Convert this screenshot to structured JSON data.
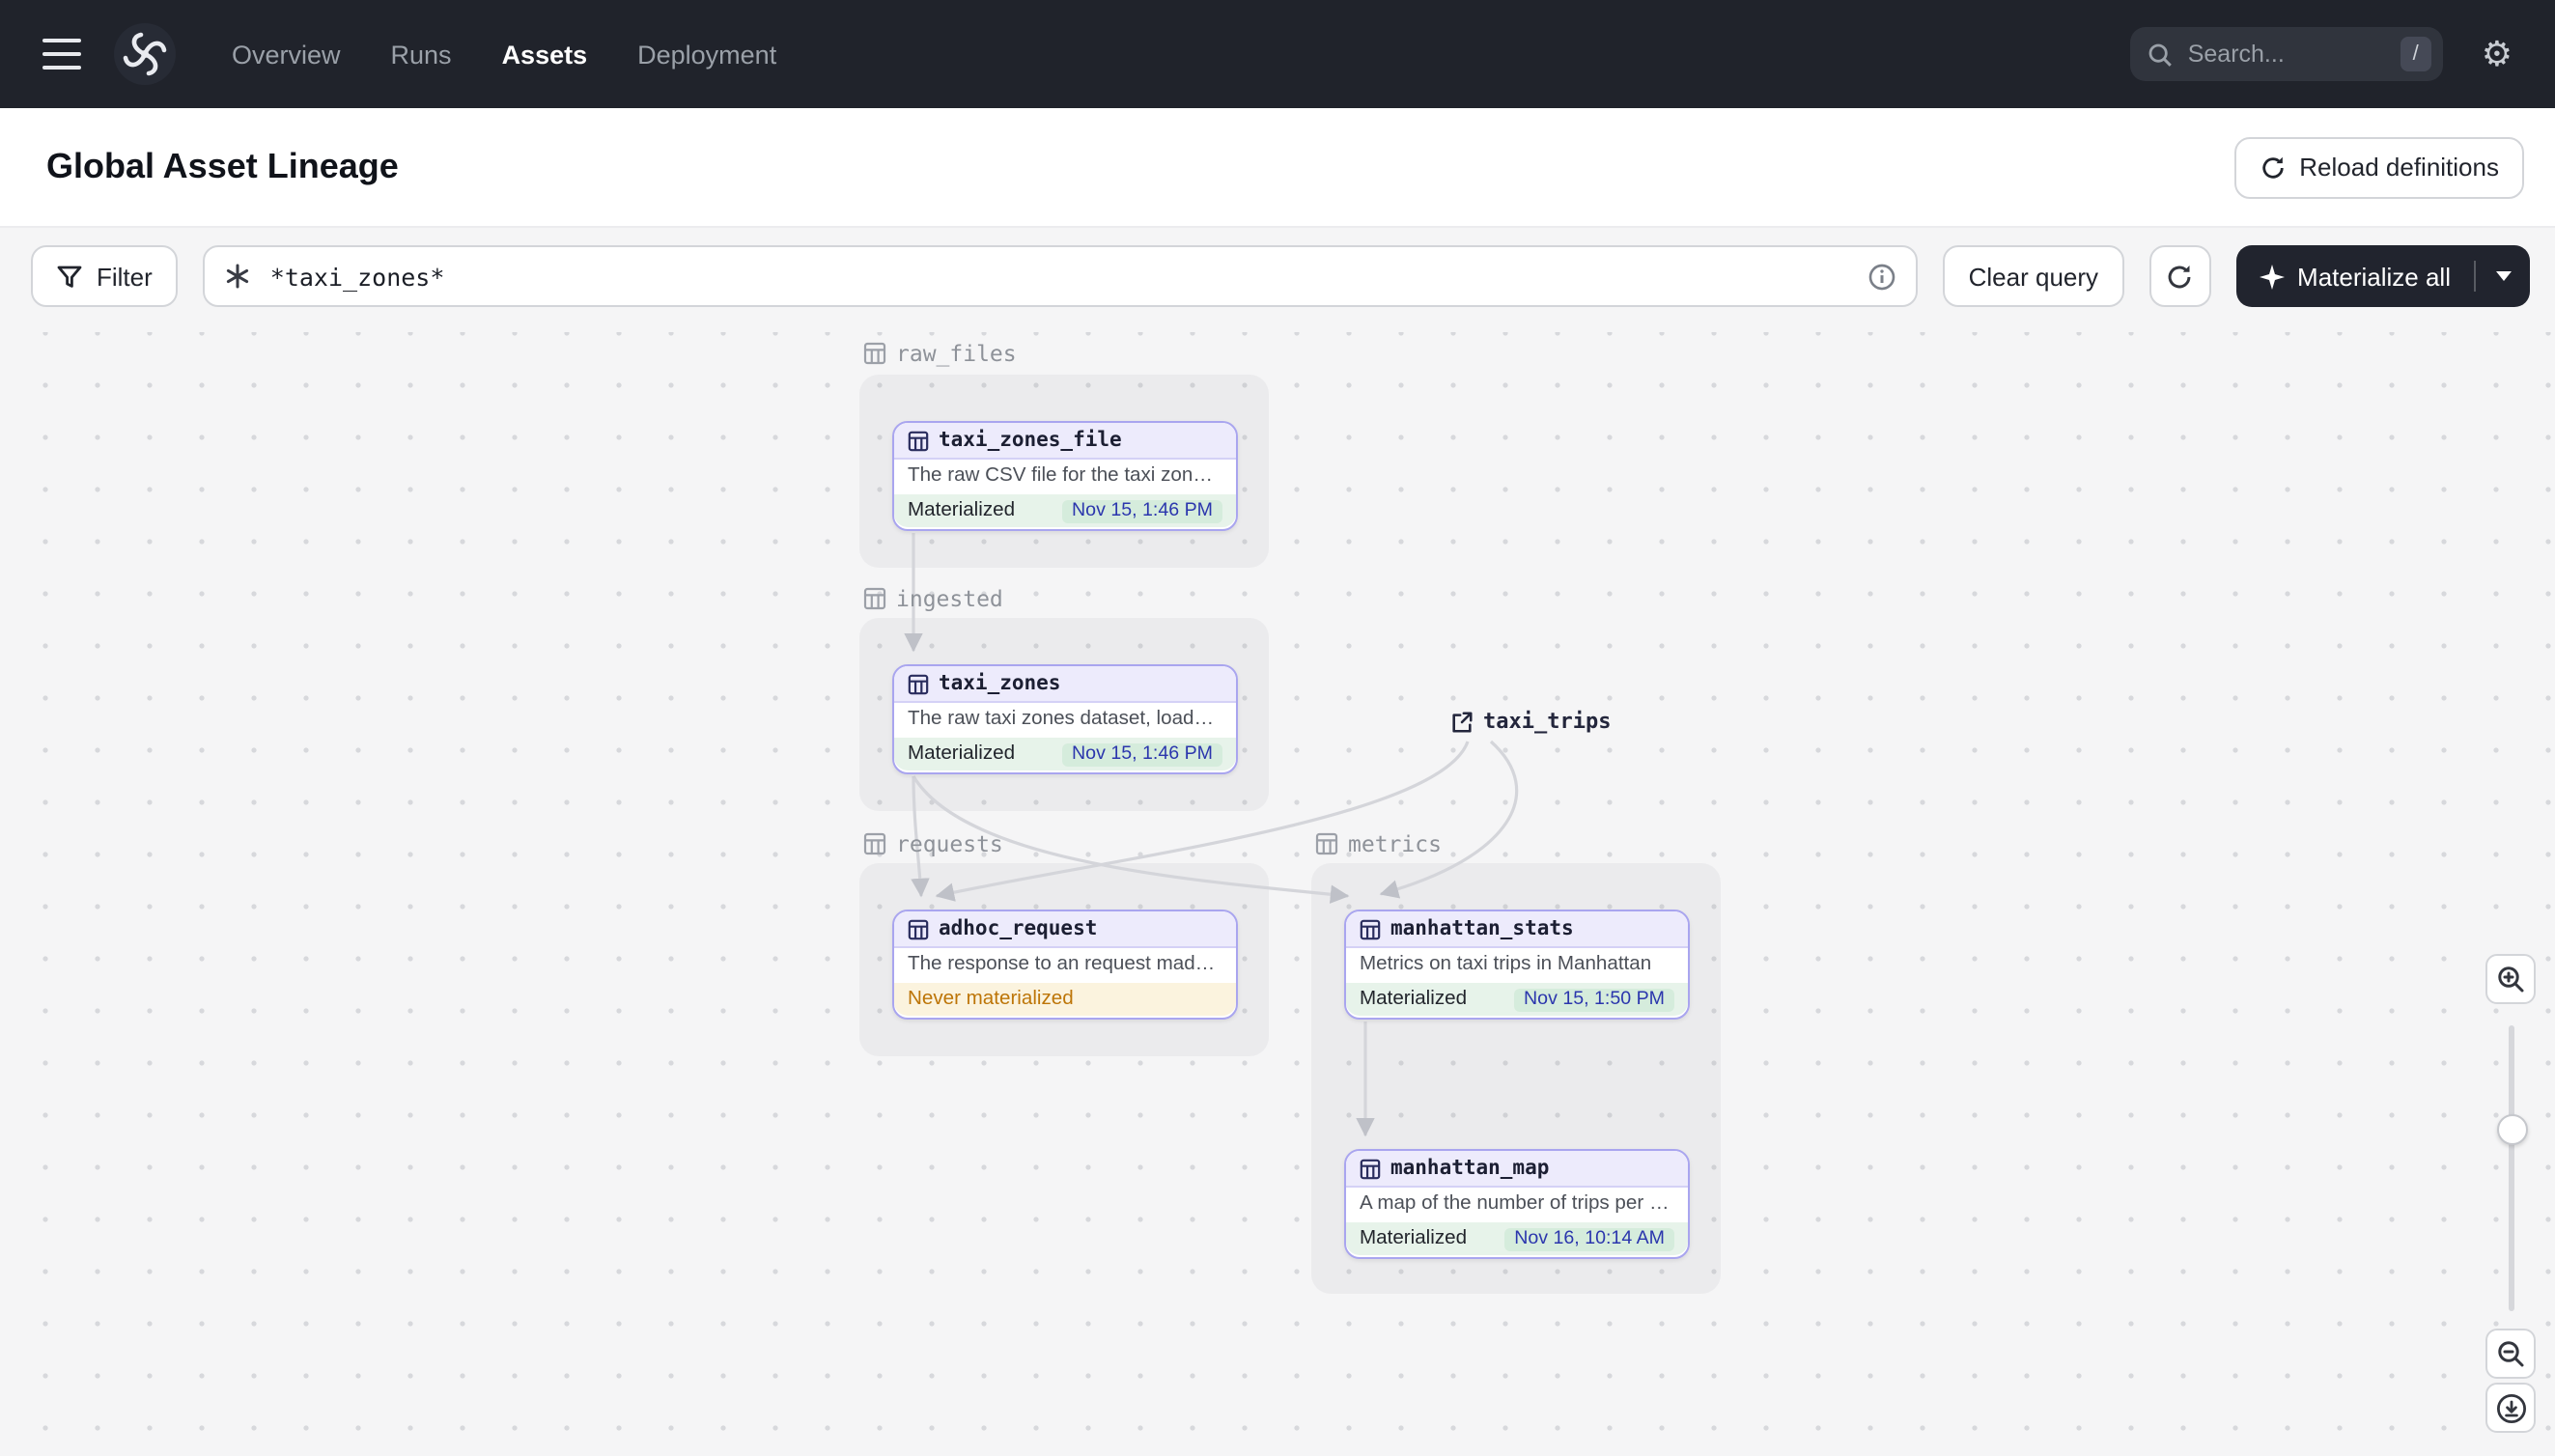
{
  "navbar": {
    "nav_items": [
      {
        "label": "Overview",
        "active": false
      },
      {
        "label": "Runs",
        "active": false
      },
      {
        "label": "Assets",
        "active": true
      },
      {
        "label": "Deployment",
        "active": false
      }
    ],
    "search_placeholder": "Search...",
    "search_shortcut": "/"
  },
  "header": {
    "title": "Global Asset Lineage",
    "reload_button": "Reload definitions"
  },
  "toolbar": {
    "filter_label": "Filter",
    "query_value": "*taxi_zones*",
    "clear_label": "Clear query",
    "materialize_label": "Materialize all"
  },
  "graph": {
    "groups": [
      {
        "name": "raw_files"
      },
      {
        "name": "ingested"
      },
      {
        "name": "requests"
      },
      {
        "name": "metrics"
      }
    ],
    "nodes": [
      {
        "name": "taxi_zones_file",
        "group": "raw_files",
        "description": "The raw CSV file for the taxi zones dat...",
        "status": "Materialized",
        "timestamp": "Nov 15, 1:46 PM"
      },
      {
        "name": "taxi_zones",
        "group": "ingested",
        "description": "The raw taxi zones dataset, loaded int...",
        "status": "Materialized",
        "timestamp": "Nov 15, 1:46 PM"
      },
      {
        "name": "adhoc_request",
        "group": "requests",
        "description": "The response to an request made in th...",
        "status": "Never materialized",
        "timestamp": ""
      },
      {
        "name": "manhattan_stats",
        "group": "metrics",
        "description": "Metrics on taxi trips in Manhattan",
        "status": "Materialized",
        "timestamp": "Nov 15, 1:50 PM"
      },
      {
        "name": "manhattan_map",
        "group": "metrics",
        "description": "A map of the number of trips per taxi z...",
        "status": "Materialized",
        "timestamp": "Nov 16, 10:14 AM"
      }
    ],
    "external_assets": [
      {
        "name": "taxi_trips"
      }
    ],
    "edges": [
      {
        "from": "taxi_zones_file",
        "to": "taxi_zones"
      },
      {
        "from": "taxi_zones",
        "to": "adhoc_request"
      },
      {
        "from": "taxi_zones",
        "to": "manhattan_stats"
      },
      {
        "from": "taxi_trips",
        "to": "adhoc_request"
      },
      {
        "from": "taxi_trips",
        "to": "manhattan_stats"
      },
      {
        "from": "manhattan_stats",
        "to": "manhattan_map"
      }
    ]
  },
  "colors": {
    "navbar_bg": "#20232b",
    "accent_purple": "#a9a5ef",
    "node_header_bg": "#edebfc",
    "materialized_bg": "#e7f3ea",
    "timestamp_color": "#2b36ad",
    "never_materialized_color": "#bd7507",
    "never_materialized_bg": "#fbf3de",
    "canvas_bg": "#f5f5f6",
    "dark_button_bg": "#21242e"
  },
  "icons": {
    "menu": "hamburger",
    "logo": "dagster-swirl",
    "search": "magnifier",
    "settings": "gear",
    "reload": "circular-arrow",
    "filter": "funnel",
    "query": "asterisk",
    "info": "info-circle",
    "materialize": "sparkle",
    "caret": "chevron-down",
    "asset": "table-grid",
    "external": "open-in-new",
    "zoom_in": "magnifier-plus",
    "zoom_out": "magnifier-minus",
    "download": "download-circle"
  }
}
